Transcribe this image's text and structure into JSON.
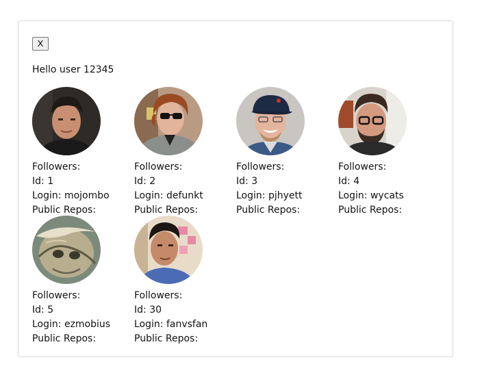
{
  "panel": {
    "close_label": "X",
    "greeting": "Hello user 12345"
  },
  "labels": {
    "followers": "Followers:",
    "id": "Id:",
    "login": "Login:",
    "public_repos": "Public Repos:"
  },
  "users": [
    {
      "id": "1",
      "login": "mojombo",
      "followers": "",
      "public_repos": ""
    },
    {
      "id": "2",
      "login": "defunkt",
      "followers": "",
      "public_repos": ""
    },
    {
      "id": "3",
      "login": "pjhyett",
      "followers": "",
      "public_repos": ""
    },
    {
      "id": "4",
      "login": "wycats",
      "followers": "",
      "public_repos": ""
    },
    {
      "id": "5",
      "login": "ezmobius",
      "followers": "",
      "public_repos": ""
    },
    {
      "id": "30",
      "login": "fanvsfan",
      "followers": "",
      "public_repos": ""
    }
  ]
}
